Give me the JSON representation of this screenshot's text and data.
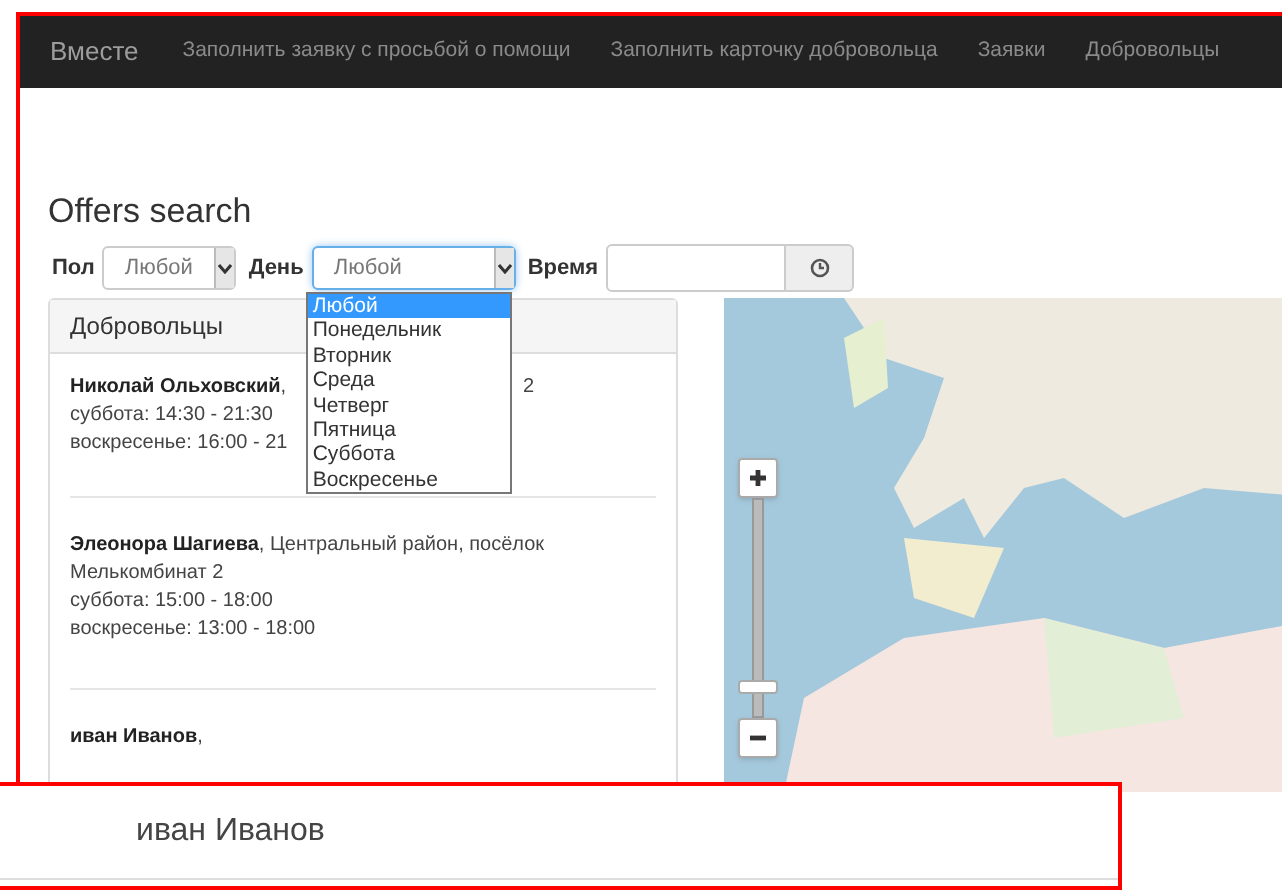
{
  "navbar": {
    "brand": "Вместе",
    "items": [
      "Заполнить заявку с просьбой о помощи",
      "Заполнить карточку добровольца",
      "Заявки",
      "Добровольцы"
    ]
  },
  "heading": "Offers search",
  "filters": [
    {
      "kind": "select",
      "label": "Пол",
      "value": "Любой",
      "open": false
    },
    {
      "kind": "select",
      "label": "День",
      "value": "Любой",
      "open": true
    },
    {
      "kind": "time",
      "label": "Время"
    }
  ],
  "day_options": [
    {
      "label": "Любой",
      "selected": true
    },
    {
      "label": "Понедельник",
      "selected": false
    },
    {
      "label": "Вторник",
      "selected": false
    },
    {
      "label": "Среда",
      "selected": false
    },
    {
      "label": "Четверг",
      "selected": false
    },
    {
      "label": "Пятница",
      "selected": false
    },
    {
      "label": "Суббота",
      "selected": false
    },
    {
      "label": "Воскресенье",
      "selected": false
    }
  ],
  "panel": {
    "title": "Добровольцы",
    "volunteers": [
      {
        "name": "Николай Ольховский",
        "address": ",",
        "address_tail": "2",
        "schedule": [
          "суббота: 14:30 - 21:30",
          "воскресенье: 16:00 - 21"
        ]
      },
      {
        "name": "Элеонора Шагиева",
        "address": ", Центральный район, посёлок Мелькомбинат 2",
        "schedule": [
          "суббота: 15:00 - 18:00",
          "воскресенье: 13:00 - 18:00"
        ]
      },
      {
        "name": "иван Иванов",
        "address": ","
      }
    ]
  },
  "map": {
    "zoom": {
      "level": 0.12
    }
  },
  "detail": {
    "name": "иван Иванов"
  }
}
